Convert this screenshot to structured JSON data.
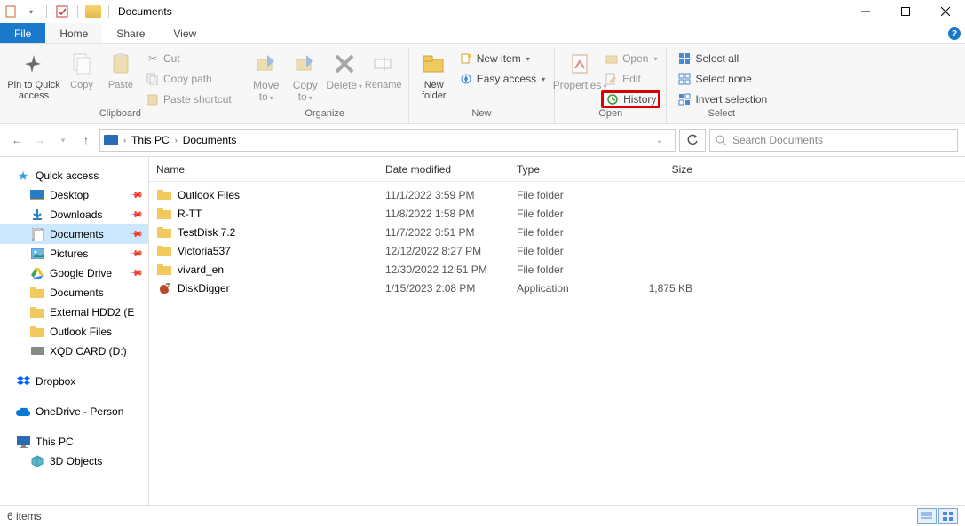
{
  "window": {
    "title": "Documents"
  },
  "menutabs": {
    "file": "File",
    "home": "Home",
    "share": "Share",
    "view": "View"
  },
  "ribbon": {
    "clipboard": {
      "label": "Clipboard",
      "pin": "Pin to Quick access",
      "copy": "Copy",
      "paste": "Paste",
      "cut": "Cut",
      "copypath": "Copy path",
      "pasteshortcut": "Paste shortcut"
    },
    "organize": {
      "label": "Organize",
      "moveto": "Move to",
      "copyto": "Copy to",
      "delete": "Delete",
      "rename": "Rename"
    },
    "new": {
      "label": "New",
      "newfolder": "New folder",
      "newitem": "New item",
      "easyaccess": "Easy access"
    },
    "open": {
      "label": "Open",
      "properties": "Properties",
      "open": "Open",
      "edit": "Edit",
      "history": "History"
    },
    "select": {
      "label": "Select",
      "selectall": "Select all",
      "selectnone": "Select none",
      "invert": "Invert selection"
    }
  },
  "breadcrumb": {
    "root": "This PC",
    "current": "Documents"
  },
  "search": {
    "placeholder": "Search Documents"
  },
  "sidebar": {
    "quickaccess": "Quick access",
    "desktop": "Desktop",
    "downloads": "Downloads",
    "documents": "Documents",
    "pictures": "Pictures",
    "googledrive": "Google Drive",
    "documents2": "Documents",
    "externalhdd": "External HDD2 (E",
    "outlook": "Outlook Files",
    "xqd": "XQD CARD (D:)",
    "dropbox": "Dropbox",
    "onedrive": "OneDrive - Person",
    "thispc": "This PC",
    "objects3d": "3D Objects"
  },
  "columns": {
    "name": "Name",
    "date": "Date modified",
    "type": "Type",
    "size": "Size"
  },
  "files": [
    {
      "name": "Outlook Files",
      "date": "11/1/2022 3:59 PM",
      "type": "File folder",
      "size": "",
      "kind": "folder"
    },
    {
      "name": "R-TT",
      "date": "11/8/2022 1:58 PM",
      "type": "File folder",
      "size": "",
      "kind": "folder"
    },
    {
      "name": "TestDisk 7.2",
      "date": "11/7/2022 3:51 PM",
      "type": "File folder",
      "size": "",
      "kind": "folder"
    },
    {
      "name": "Victoria537",
      "date": "12/12/2022 8:27 PM",
      "type": "File folder",
      "size": "",
      "kind": "folder"
    },
    {
      "name": "vivard_en",
      "date": "12/30/2022 12:51 PM",
      "type": "File folder",
      "size": "",
      "kind": "folder"
    },
    {
      "name": "DiskDigger",
      "date": "1/15/2023 2:08 PM",
      "type": "Application",
      "size": "1,875 KB",
      "kind": "app"
    }
  ],
  "status": {
    "count": "6 items"
  }
}
